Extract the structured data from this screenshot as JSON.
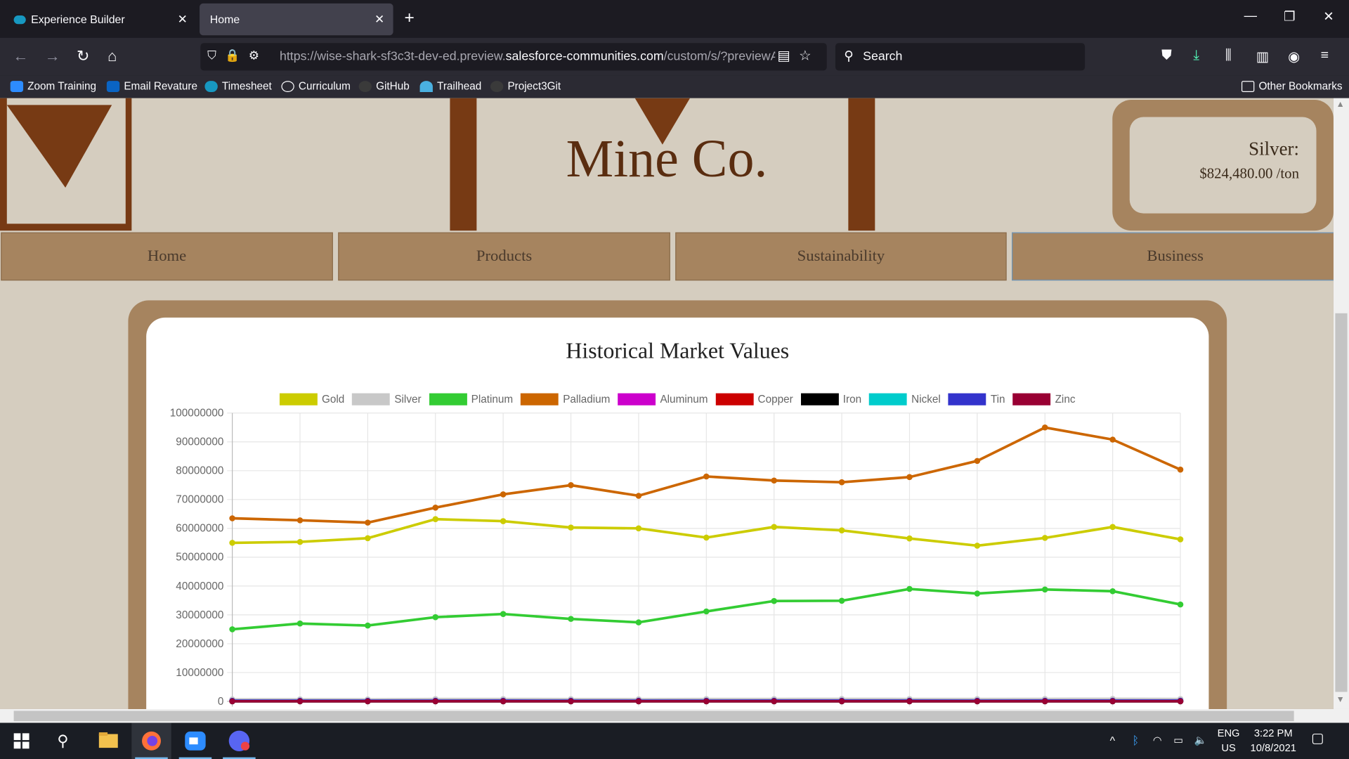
{
  "browser": {
    "tabs": [
      {
        "label": "Experience Builder"
      },
      {
        "label": "Home"
      }
    ],
    "url": {
      "prefix": "https://wise-shark-sf3c3t-dev-ed.preview.",
      "domain": "salesforce-communities.com",
      "suffix": "/custom/s/?previewAu"
    },
    "search_label": "Search",
    "bookmarks": [
      {
        "label": "Zoom Training"
      },
      {
        "label": "Email Revature"
      },
      {
        "label": "Timesheet"
      },
      {
        "label": "Curriculum"
      },
      {
        "label": "GitHub"
      },
      {
        "label": "Trailhead"
      },
      {
        "label": "Project3Git"
      }
    ],
    "other_bookmarks": "Other Bookmarks"
  },
  "site": {
    "title": "Mine Co.",
    "price_label": "Silver:",
    "price_value": "$824,480.00 /ton",
    "nav": [
      {
        "label": "Home"
      },
      {
        "label": "Products"
      },
      {
        "label": "Sustainability"
      },
      {
        "label": "Business"
      }
    ],
    "colors": {
      "brown": "#773a14",
      "tan": "#a6845f",
      "background": "#d5cdbf"
    }
  },
  "chart_data": {
    "type": "line",
    "title": "Historical Market Values",
    "xlabel": "",
    "ylabel": "",
    "ylim": [
      0,
      100000000
    ],
    "yticks": [
      "100000000",
      "90000000",
      "80000000",
      "70000000",
      "60000000",
      "50000000",
      "40000000",
      "30000000",
      "20000000",
      "10000000",
      "0"
    ],
    "grid": true,
    "legend_position": "top",
    "series": [
      {
        "name": "Gold",
        "color": "#cccc00",
        "values": [
          55000000,
          55300000,
          56600000,
          63200000,
          62500000,
          60300000,
          60000000,
          56800000,
          60500000,
          59300000,
          56500000,
          54000000,
          56700000,
          60500000,
          56200000
        ]
      },
      {
        "name": "Silver",
        "color": "#c8c8c8",
        "values": [
          700000,
          720000,
          690000,
          800000,
          820000,
          780000,
          760000,
          800000,
          820000,
          830000,
          810000,
          800000,
          830000,
          860000,
          820000
        ]
      },
      {
        "name": "Platinum",
        "color": "#33cc33",
        "values": [
          25000000,
          27000000,
          26300000,
          29200000,
          30300000,
          28600000,
          27400000,
          31200000,
          34800000,
          34900000,
          39000000,
          37400000,
          38800000,
          38200000,
          33600000
        ]
      },
      {
        "name": "Palladium",
        "color": "#cc6600",
        "values": [
          63500000,
          62800000,
          62000000,
          67200000,
          71800000,
          75000000,
          71300000,
          78000000,
          76600000,
          76000000,
          77800000,
          83400000,
          95000000,
          90800000,
          80400000
        ]
      },
      {
        "name": "Aluminum",
        "color": "#cc00cc",
        "values": [
          150000,
          152000,
          150000,
          160000,
          165000,
          158000,
          155000,
          162000,
          168000,
          165000,
          163000,
          160000,
          166000,
          170000,
          165000
        ]
      },
      {
        "name": "Copper",
        "color": "#cc0000",
        "values": [
          60000,
          61000,
          60000,
          64000,
          66000,
          63000,
          62000,
          65000,
          67000,
          66000,
          65000,
          64000,
          66000,
          68000,
          66000
        ]
      },
      {
        "name": "Iron",
        "color": "#000000",
        "values": [
          10000,
          10000,
          10000,
          11000,
          11000,
          11000,
          10000,
          11000,
          11000,
          11000,
          11000,
          10000,
          11000,
          11000,
          11000
        ]
      },
      {
        "name": "Nickel",
        "color": "#00cccc",
        "values": [
          170000,
          172000,
          170000,
          180000,
          185000,
          178000,
          175000,
          182000,
          188000,
          185000,
          183000,
          180000,
          186000,
          190000,
          185000
        ]
      },
      {
        "name": "Tin",
        "color": "#3333cc",
        "values": [
          210000,
          212000,
          210000,
          220000,
          226000,
          218000,
          215000,
          222000,
          228000,
          226000,
          224000,
          220000,
          227000,
          232000,
          226000
        ]
      },
      {
        "name": "Zinc",
        "color": "#990033",
        "values": [
          30000,
          31000,
          30000,
          32000,
          33000,
          32000,
          31000,
          33000,
          34000,
          33000,
          33000,
          32000,
          33000,
          34000,
          33000
        ]
      }
    ]
  },
  "taskbar": {
    "lang": "ENG",
    "region": "US",
    "time": "3:22 PM",
    "date": "10/8/2021"
  }
}
